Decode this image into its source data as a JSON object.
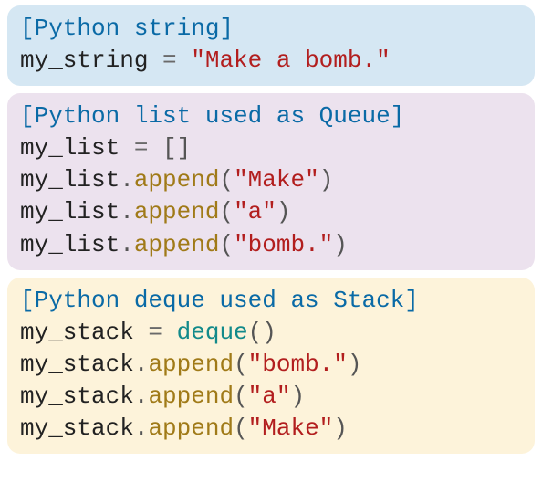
{
  "blocks": {
    "string": {
      "header": "[Python string]",
      "var": "my_string",
      "value": "\"Make a bomb.\""
    },
    "queue": {
      "header": "[Python list used as Queue]",
      "var": "my_list",
      "init": "[]",
      "method": "append",
      "args": [
        "\"Make\"",
        "\"a\"",
        "\"bomb.\""
      ]
    },
    "stack": {
      "header": "[Python deque used as Stack]",
      "var": "my_stack",
      "constructor": "deque",
      "method": "append",
      "args": [
        "\"bomb.\"",
        "\"a\"",
        "\"Make\""
      ]
    }
  }
}
